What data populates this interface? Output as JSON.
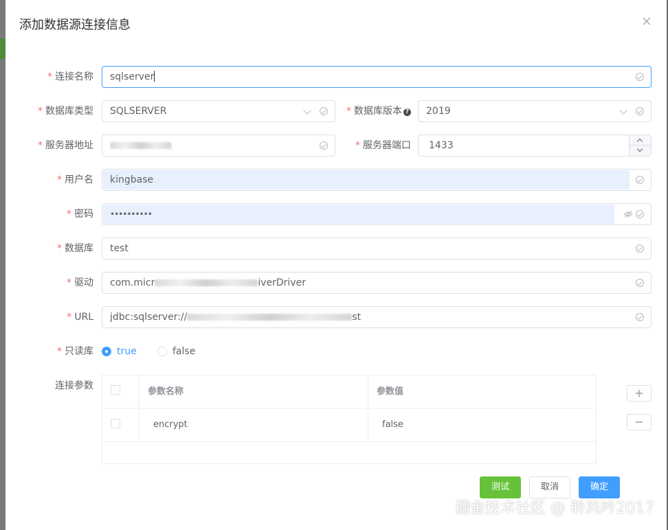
{
  "dialog": {
    "title": "添加数据源连接信息"
  },
  "form": {
    "required_mark": "*",
    "connection_name": {
      "label": "连接名称",
      "value": "sqlserver"
    },
    "db_type": {
      "label": "数据库类型",
      "value": "SQLSERVER"
    },
    "db_version": {
      "label": "数据库版本",
      "help_glyph": "?",
      "value": "2019"
    },
    "server_address": {
      "label": "服务器地址"
    },
    "server_port": {
      "label": "服务器端口",
      "value": "1433"
    },
    "username": {
      "label": "用户名",
      "value": "kingbase"
    },
    "password": {
      "label": "密码",
      "value": "••••••••••"
    },
    "database": {
      "label": "数据库",
      "value": "test"
    },
    "driver": {
      "label": "驱动",
      "value_prefix": "com.micr",
      "value_suffix": "iverDriver"
    },
    "url": {
      "label": "URL",
      "value_prefix": "jdbc:sqlserver://",
      "value_suffix": "st"
    },
    "readonly": {
      "label": "只读库",
      "options": [
        "true",
        "false"
      ],
      "selected": "true"
    },
    "params": {
      "label": "连接参数",
      "columns": [
        "参数名称",
        "参数值"
      ],
      "rows": [
        {
          "name": "encrypt",
          "value": "false"
        }
      ],
      "add_glyph": "+",
      "remove_glyph": "−"
    }
  },
  "buttons": {
    "test": "测试",
    "cancel": "取消",
    "confirm": "确定"
  },
  "colors": {
    "primary": "#409eff",
    "success": "#67c23a",
    "danger": "#f56c6c",
    "autofill": "#e8f0fe"
  },
  "watermark": "掘金技术社区 @ 聆风吟2017"
}
